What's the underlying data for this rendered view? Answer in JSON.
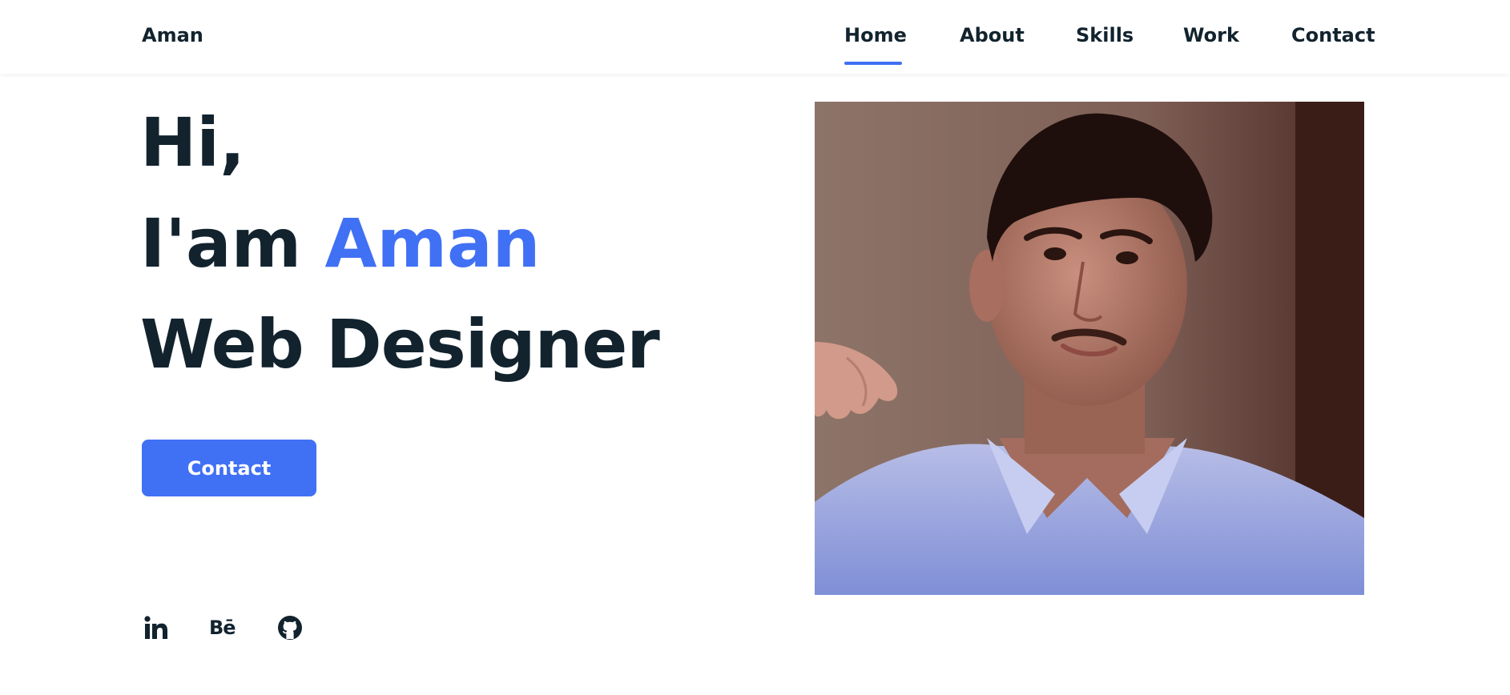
{
  "header": {
    "logo": "Aman",
    "nav": [
      {
        "label": "Home",
        "active": true
      },
      {
        "label": "About",
        "active": false
      },
      {
        "label": "Skills",
        "active": false
      },
      {
        "label": "Work",
        "active": false
      },
      {
        "label": "Contact",
        "active": false
      }
    ]
  },
  "hero": {
    "line1": "Hi,",
    "line2_prefix": "I'am ",
    "line2_name": "Aman",
    "line3": "Web Designer",
    "cta_label": "Contact"
  },
  "social": {
    "behance_text": "Bē",
    "icons": [
      "linkedin-icon",
      "behance-icon",
      "github-icon"
    ]
  },
  "colors": {
    "accent": "#4070f4",
    "text": "#12232e",
    "background": "#ffffff"
  }
}
